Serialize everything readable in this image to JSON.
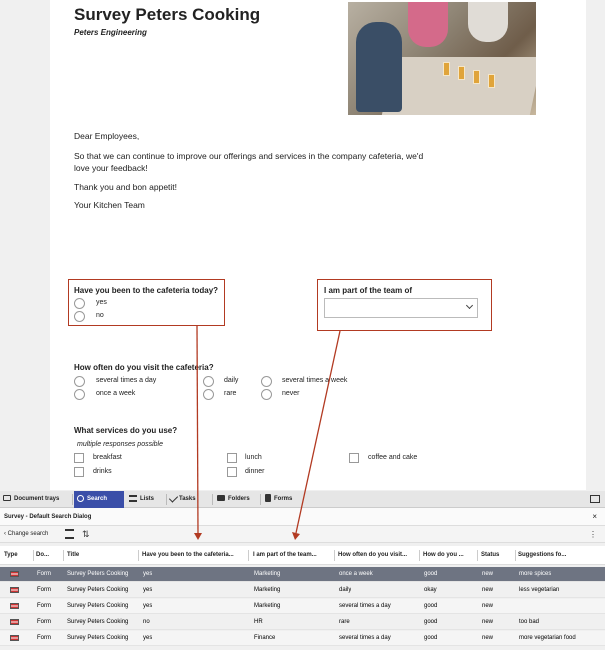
{
  "document": {
    "title": "Survey Peters Cooking",
    "subtitle": "Peters Engineering",
    "greeting": "Dear Employees,",
    "intro_line1": "So that we can continue to improve our offerings and services in the company cafeteria, we'd",
    "intro_line2": "love your feedback!",
    "thanks": "Thank you and bon appetit!",
    "signature": "Your Kitchen Team",
    "q1": {
      "title": "Have you been to the cafeteria today?",
      "options": [
        "yes",
        "no"
      ]
    },
    "q2": {
      "title": "I am part of the team of",
      "value": ""
    },
    "q3": {
      "title": "How often do you visit the cafeteria?",
      "options": [
        "several times a day",
        "daily",
        "several times a week",
        "once a week",
        "rare",
        "never"
      ]
    },
    "q4": {
      "title": "What services do you use?",
      "hint": "multiple responses possible",
      "options": [
        "breakfast",
        "lunch",
        "coffee and cake",
        "drinks",
        "dinner"
      ]
    }
  },
  "tabs": [
    {
      "label": "Document trays",
      "icon": "tray-icon"
    },
    {
      "label": "Search",
      "icon": "search-icon",
      "active": true
    },
    {
      "label": "Lists",
      "icon": "list-icon"
    },
    {
      "label": "Tasks",
      "icon": "checkmark-icon"
    },
    {
      "label": "Folders",
      "icon": "folder-icon"
    },
    {
      "label": "Forms",
      "icon": "clipboard-icon"
    }
  ],
  "dialog": {
    "title": "Survey - Default Search Dialog",
    "close": "×"
  },
  "toolbar": {
    "back_label": "Change search",
    "more": "⋮"
  },
  "grid": {
    "columns": [
      "Type",
      "Do...",
      "Title",
      "Have you been to the cafeteria...",
      "I am part of the team...",
      "How often do you visit...",
      "How do you ...",
      "Status",
      "Suggestions fo..."
    ],
    "rows": [
      [
        "",
        "Form",
        "Survey Peters Cooking",
        "yes",
        "Marketing",
        "once a week",
        "good",
        "new",
        "more spices"
      ],
      [
        "",
        "Form",
        "Survey Peters Cooking",
        "yes",
        "Marketing",
        "daily",
        "okay",
        "new",
        "less vegetarian"
      ],
      [
        "",
        "Form",
        "Survey Peters Cooking",
        "yes",
        "Marketing",
        "several times a day",
        "good",
        "new",
        ""
      ],
      [
        "",
        "Form",
        "Survey Peters Cooking",
        "no",
        "HR",
        "rare",
        "good",
        "new",
        "too bad"
      ],
      [
        "",
        "Form",
        "Survey Peters Cooking",
        "yes",
        "Finance",
        "several times a day",
        "good",
        "new",
        "more vegetarian food"
      ]
    ]
  },
  "colors": {
    "accent": "#3a4ea8",
    "highlight": "#b23a22",
    "selected_row": "#6e7482"
  }
}
